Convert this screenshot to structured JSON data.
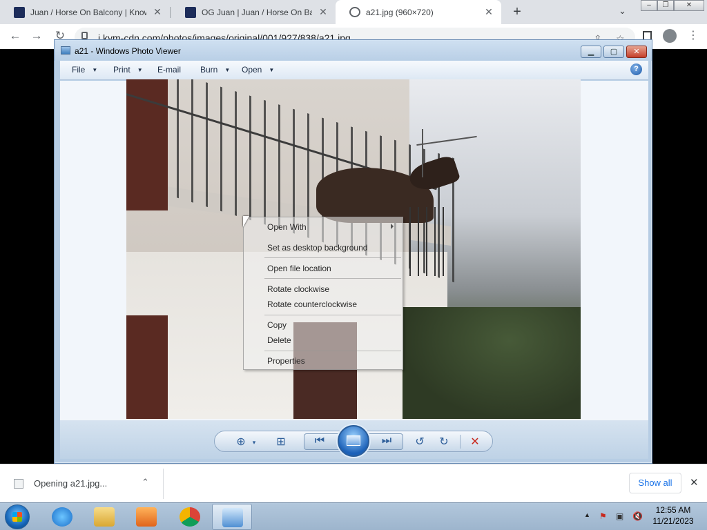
{
  "browser": {
    "tabs": [
      {
        "title": "Juan / Horse On Balcony | Know",
        "active": false
      },
      {
        "title": "OG Juan | Juan / Horse On Balco",
        "active": false
      },
      {
        "title": "a21.jpg (960×720)",
        "active": true
      }
    ],
    "url": "i.kym-cdn.com/photos/images/original/001/927/838/a21.jpg"
  },
  "viewer": {
    "title": "a21 - Windows Photo Viewer",
    "menu": [
      {
        "label": "File"
      },
      {
        "label": "Print"
      },
      {
        "label": "E-mail"
      },
      {
        "label": "Burn"
      },
      {
        "label": "Open"
      }
    ],
    "help_label": "?"
  },
  "context_menu": {
    "items": [
      {
        "label": "Open With",
        "has_submenu": true
      },
      {
        "label": "Set as desktop background"
      },
      {
        "label": "Open file location"
      },
      {
        "label": "Rotate clockwise"
      },
      {
        "label": "Rotate counterclockwise"
      },
      {
        "label": "Copy"
      },
      {
        "label": "Delete"
      },
      {
        "label": "Properties"
      }
    ]
  },
  "download_bar": {
    "file_text": "Opening a21.jpg...",
    "show_all_label": "Show all"
  },
  "taskbar": {
    "clock_time": "12:55 AM",
    "clock_date": "11/21/2023"
  },
  "colors": {
    "chrome_accent": "#1a73e8",
    "viewer_frame": "#b7cde4",
    "delete_red": "#c8281c"
  }
}
